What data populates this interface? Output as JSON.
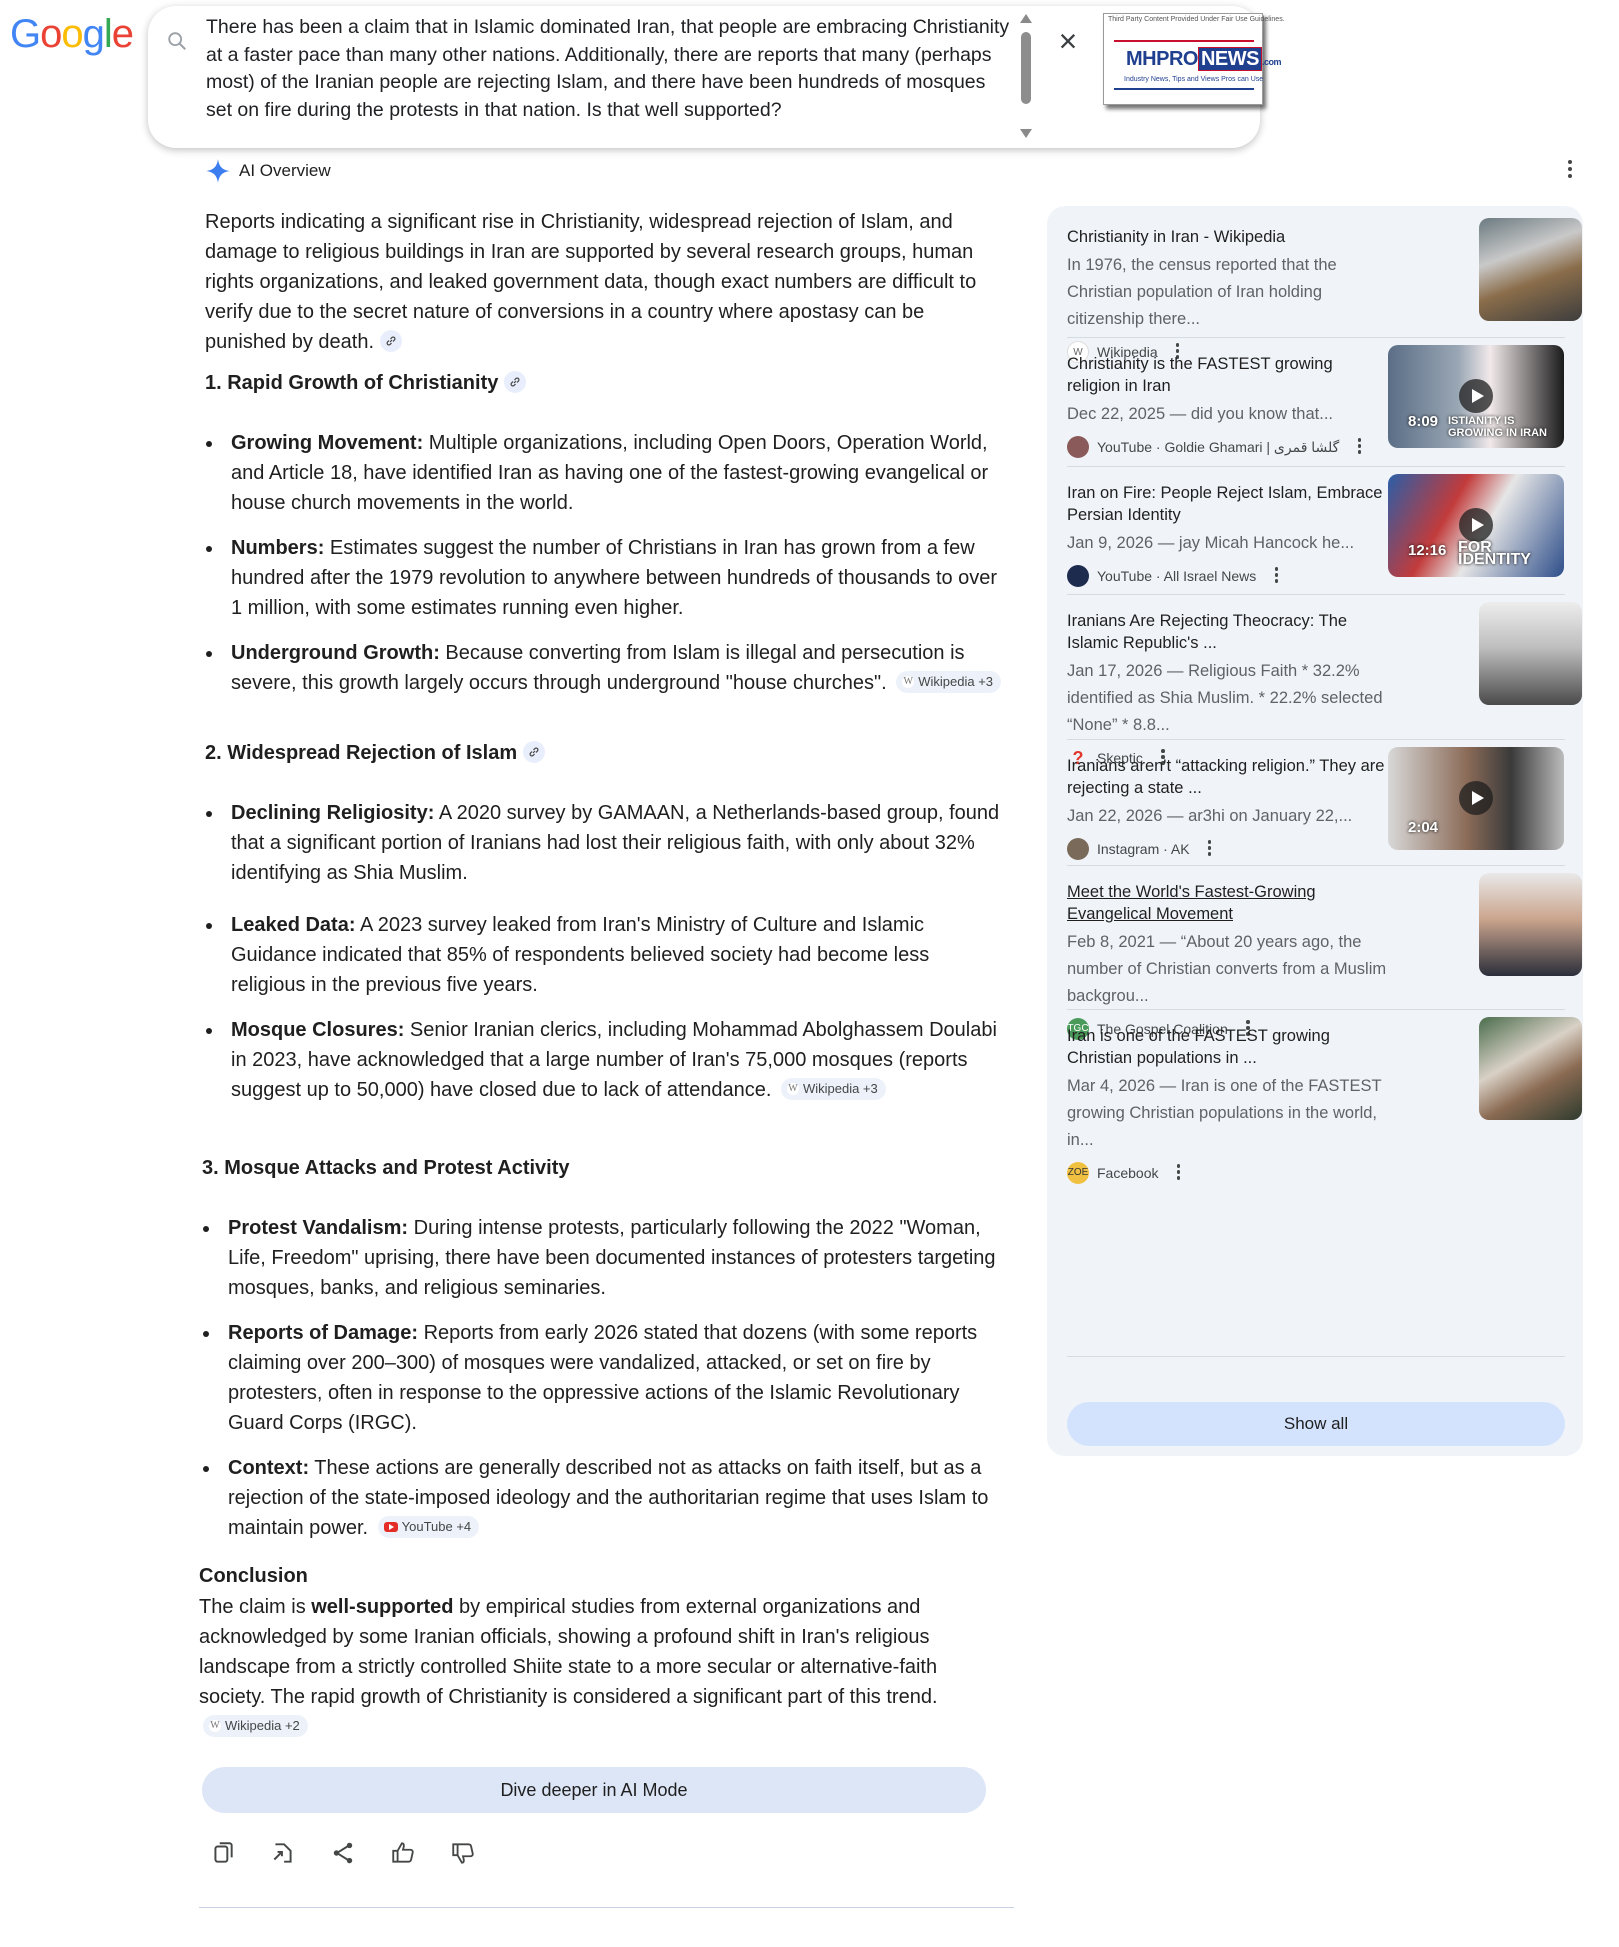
{
  "header": {
    "logo_letters": [
      {
        "ch": "G",
        "color": "#4285F4"
      },
      {
        "ch": "o",
        "color": "#EA4335"
      },
      {
        "ch": "o",
        "color": "#FBBC05"
      },
      {
        "ch": "g",
        "color": "#4285F4"
      },
      {
        "ch": "l",
        "color": "#34A853"
      },
      {
        "ch": "e",
        "color": "#EA4335"
      }
    ],
    "query": "There has been a claim that in Islamic dominated Iran, that people are embracing Christianity at a faster pace than many other nations. Additionally, there are reports that many (perhaps most) of the Iranian people are rejecting Islam, and there have been hundreds of mosques set on fire during the protests in that nation. Is that well supported?",
    "clear_icon": "close-icon",
    "watermark": {
      "note": "Third Party Content Provided Under Fair Use Guidelines.",
      "brand_left": "MHPRO",
      "brand_box": "NEWS",
      "brand_suffix": ".com",
      "tagline": "Industry News, Tips and Views Pros can Use"
    }
  },
  "aio": {
    "label": "AI Overview",
    "intro": "Reports indicating a significant rise in Christianity, widespread rejection of Islam, and damage to religious buildings in Iran are supported by several research groups, human rights organizations, and leaked government data, though exact numbers are difficult to verify due to the secret nature of conversions in a country where apostasy can be punished by death.",
    "sections": [
      {
        "heading": "1. Rapid Growth of Christianity",
        "items": [
          {
            "bold": "Growing Movement:",
            "text": " Multiple organizations, including Open Doors, Operation World, and Article 18, have identified Iran as having one of the fastest-growing evangelical or house church movements in the world.",
            "chip": ""
          },
          {
            "bold": "Numbers:",
            "text": " Estimates suggest the number of Christians in Iran has grown from a few hundred after the 1979 revolution to anywhere between hundreds of thousands to over 1 million, with some estimates running even higher.",
            "chip": ""
          },
          {
            "bold": "Underground Growth:",
            "text": " Because converting from Islam is illegal and persecution is severe, this growth largely occurs through underground \"house churches\".",
            "chip": "Wikipedia +3"
          }
        ]
      },
      {
        "heading": "2. Widespread Rejection of Islam",
        "items": [
          {
            "bold": "Declining Religiosity:",
            "text": " A 2020 survey by GAMAAN, a Netherlands-based group, found that a significant portion of Iranians had lost their religious faith, with only about 32% identifying as Shia Muslim.",
            "chip": ""
          },
          {
            "bold": "Leaked Data:",
            "text": " A 2023 survey leaked from Iran's Ministry of Culture and Islamic Guidance indicated that 85% of respondents believed society had become less religious in the previous five years.",
            "chip": ""
          },
          {
            "bold": "Mosque Closures:",
            "text": " Senior Iranian clerics, including Mohammad Abolghassem Doulabi in 2023, have acknowledged that a large number of Iran's 75,000 mosques (reports suggest up to 50,000) have closed due to lack of attendance.",
            "chip": "Wikipedia +3"
          }
        ]
      },
      {
        "heading": "3. Mosque Attacks and Protest Activity",
        "items": [
          {
            "bold": "Protest Vandalism:",
            "text": " During intense protests, particularly following the 2022 \"Woman, Life, Freedom\" uprising, there have been documented instances of protesters targeting mosques, banks, and religious seminaries.",
            "chip": ""
          },
          {
            "bold": "Reports of Damage:",
            "text": " Reports from early 2026 stated that dozens (with some reports claiming over 200–300) of mosques were vandalized, attacked, or set on fire by protesters, often in response to the oppressive actions of the Islamic Revolutionary Guard Corps (IRGC).",
            "chip": ""
          },
          {
            "bold": "Context:",
            "text": " These actions are generally described not as attacks on faith itself, but as a rejection of the state-imposed ideology and the authoritarian regime that uses Islam to maintain power.",
            "chip": "YouTube +4"
          }
        ]
      }
    ],
    "conclusion_heading": "Conclusion",
    "conclusion_pre": "The claim is ",
    "conclusion_bold": "well-supported",
    "conclusion_post": " by empirical studies from external organizations and acknowledged by some Iranian officials, showing a profound shift in Iran's religious landscape from a strictly controlled Shiite state to a more secular or alternative-faith society. The rapid growth of Christianity is considered a significant part of this trend.",
    "conclusion_chip": "Wikipedia +2",
    "dive_label": "Dive deeper in AI Mode",
    "actions": [
      "copy-icon",
      "export-icon",
      "share-icon",
      "thumbs-up-icon",
      "thumbs-down-icon"
    ]
  },
  "sources": {
    "cards": [
      {
        "title": "Christianity in Iran - Wikipedia",
        "snippet": "In 1976, the census reported that the Christian population of Iran holding citizenship there...",
        "source": "Wikipedia",
        "duration": "",
        "underline": false
      },
      {
        "title": "Christianity is the FASTEST growing religion in Iran",
        "snippet": "Dec 22, 2025 — did you know that...",
        "source": "YouTube · Goldie Ghamari | گلشا قمری",
        "duration": "8:09",
        "overlay": "ISTIANITY IS GROWING IN IRAN",
        "underline": false
      },
      {
        "title": "Iran on Fire: People Reject Islam, Embrace Persian Identity",
        "snippet": "Jan 9, 2026 — jay Micah Hancock he...",
        "source": "YouTube · All Israel News",
        "duration": "12:16",
        "overlay": "FOR IDENTITY",
        "underline": false
      },
      {
        "title": "Iranians Are Rejecting Theocracy: The Islamic Republic's ...",
        "snippet": "Jan 17, 2026 — Religious Faith * 32.2% identified as Shia Muslim. * 22.2% selected “None” * 8.8...",
        "source": "Skeptic",
        "duration": "",
        "underline": false
      },
      {
        "title": "Iranians aren't “attacking religion.” They are rejecting a state ...",
        "snippet": "Jan 22, 2026 — ar3hi on January 22,...",
        "source": "Instagram · AK",
        "duration": "2:04",
        "underline": false
      },
      {
        "title": "Meet the World's Fastest-Growing Evangelical Movement",
        "snippet": "Feb 8, 2021 — “About 20 years ago, the number of Christian converts from a Muslim backgrou...",
        "source": "The Gospel Coalition",
        "duration": "",
        "underline": true
      },
      {
        "title": "Iran is one of the FASTEST growing Christian populations in ...",
        "snippet": "Mar 4, 2026 — Iran is one of the FASTEST growing Christian populations in the world, in...",
        "source": "Facebook",
        "duration": "",
        "underline": false
      }
    ],
    "show_all": "Show all"
  }
}
